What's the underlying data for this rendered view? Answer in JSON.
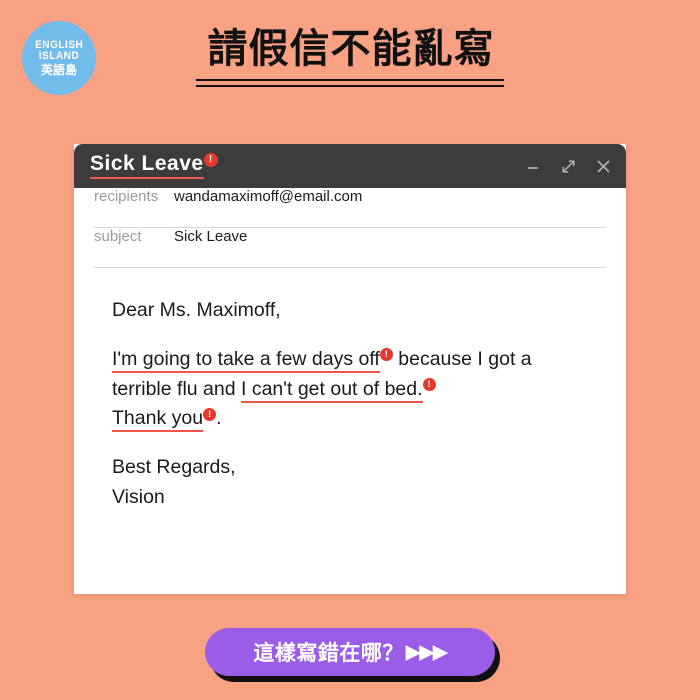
{
  "theme": {
    "background": "#F9A183",
    "titlebar": "#3C3C3C",
    "accent_red": "#F0574A",
    "badge_red": "#E8382B",
    "cta_purple": "#9B5DE8",
    "logo_blue": "#72BCEC"
  },
  "logo": {
    "line1": "ENGLISH",
    "line2": "ISLAND",
    "line3": "英語島"
  },
  "headline": {
    "text": "請假信不能亂寫"
  },
  "window": {
    "title": "Sick Leave",
    "badge": "!",
    "controls": {
      "minimize": "—",
      "expand": "⤢",
      "close": "✕"
    },
    "fields": [
      {
        "label": "recipients",
        "value": "wandamaximoff@email.com"
      },
      {
        "label": "subject",
        "value": "Sick Leave"
      }
    ],
    "body": {
      "greeting": "Dear Ms. Maximoff,",
      "para_seg1": "I'm going to take a few days off",
      "para_badge1": "!",
      "para_seg2": " because I got a terrible flu and ",
      "para_seg3": "I can't get out of bed.",
      "para_badge2": "!",
      "para_seg4": "Thank you",
      "para_badge3": "!",
      "para_seg5": ".",
      "signoff": "Best Regards,",
      "sender": "Vision"
    }
  },
  "cta": {
    "label": "這樣寫錯在哪？",
    "arrows": "▶▶▶"
  }
}
